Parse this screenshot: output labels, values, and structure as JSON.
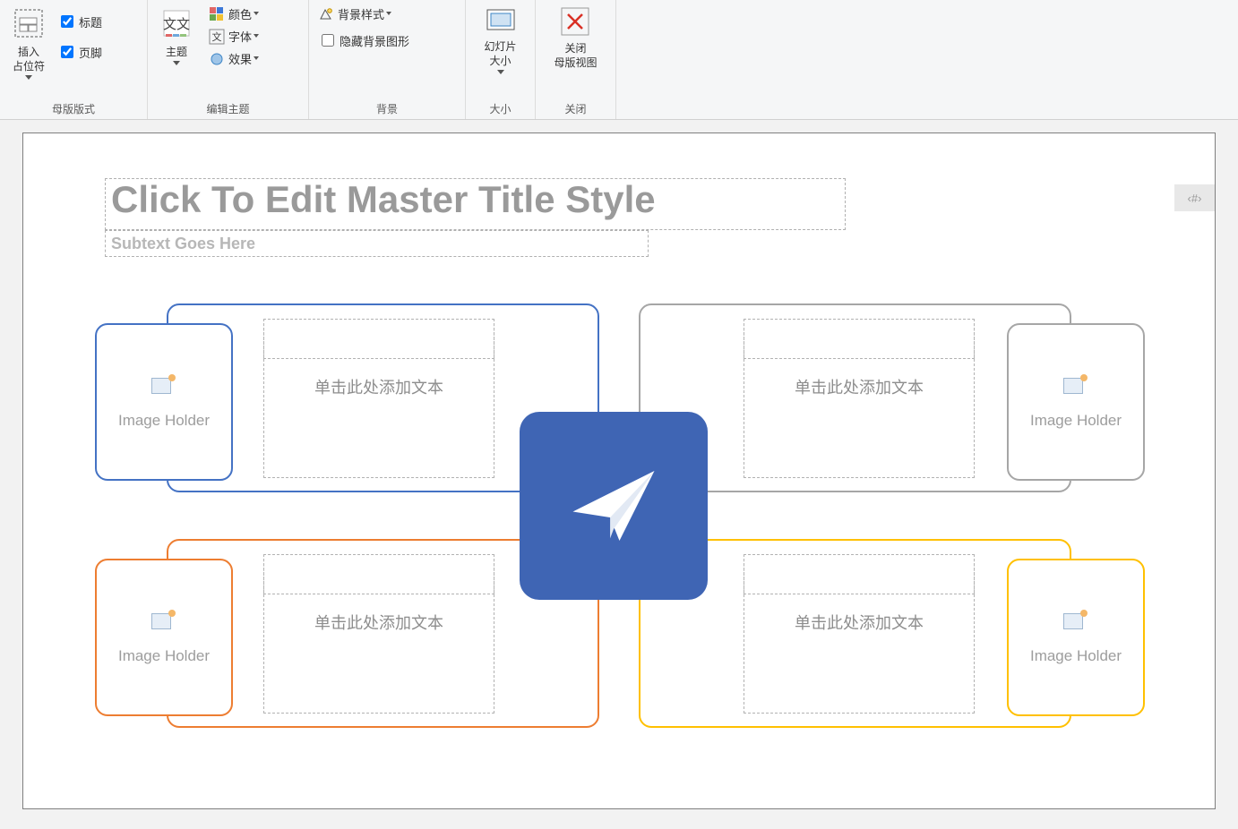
{
  "ribbon": {
    "group_master_layout": {
      "insert_placeholder": "插入\n占位符",
      "cb_title": "标题",
      "cb_footer": "页脚",
      "label": "母版版式"
    },
    "group_edit_theme": {
      "themes": "主题",
      "color": "颜色",
      "font": "字体",
      "effects": "效果",
      "label": "编辑主题"
    },
    "group_background": {
      "bg_styles": "背景样式",
      "hide_bg_graphics": "隐藏背景图形",
      "label": "背景"
    },
    "group_size": {
      "slide_size": "幻灯片\n大小",
      "label": "大小"
    },
    "group_close": {
      "close_master": "关闭\n母版视图",
      "label": "关闭"
    }
  },
  "slide": {
    "title": "Click To Edit Master Title Style",
    "subtitle": "Subtext Goes Here",
    "slidenum": "‹#›",
    "text_placeholder_hint": "单击此处添加文本",
    "image_holder_label": "Image Holder",
    "colors": {
      "blue": "#4472c4",
      "gray": "#a6a6a6",
      "orange": "#ed7d31",
      "yellow": "#ffc000",
      "center": "#3f65b4"
    }
  }
}
